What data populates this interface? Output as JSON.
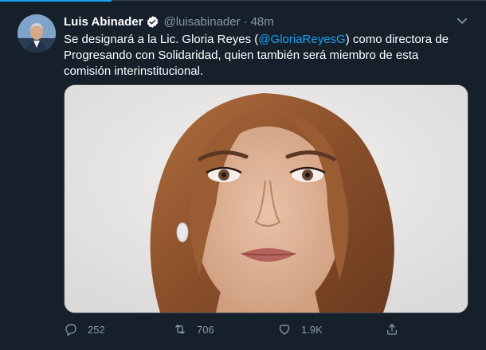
{
  "tweet": {
    "author_name": "Luis Abinader",
    "handle": "@luisabinader",
    "separator": "·",
    "time": "48m",
    "text_before": "Se designará a la Lic. Gloria Reyes (",
    "mention": "@GloriaReyesG",
    "text_after": ") como directora de Progresando con Solidaridad, quien también será miembro de esta comisión interinstitucional."
  },
  "actions": {
    "reply_count": "252",
    "retweet_count": "706",
    "like_count": "1.9K"
  },
  "icons": {
    "verified": "verified-badge-icon",
    "caret": "chevron-down-icon",
    "reply": "reply-icon",
    "retweet": "retweet-icon",
    "like": "heart-icon",
    "share": "share-icon"
  },
  "colors": {
    "background": "#15202b",
    "accent": "#1da1f2",
    "muted": "#8899a6"
  }
}
